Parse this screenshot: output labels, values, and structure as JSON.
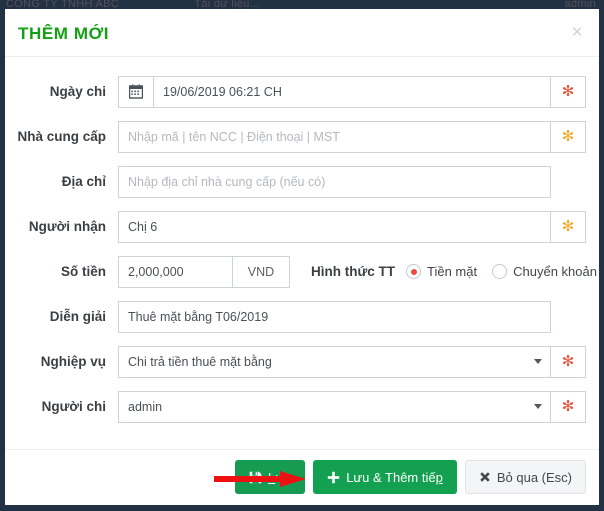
{
  "background": {
    "strip_left": "CÔNG TY TNHH ABC",
    "strip_mid": "Tải dữ liệu...",
    "strip_right": "admin",
    "color": "#233145"
  },
  "modal": {
    "title": "THÊM MỚI",
    "title_color": "#13a014",
    "close_icon": "close-icon",
    "close_label": "×"
  },
  "form": {
    "rows": [
      {
        "label": "Ngày chi",
        "type": "date",
        "icon": "calendar-icon",
        "value": "19/06/2019 06:21 CH",
        "required_mark": "✻",
        "required_color": "red"
      },
      {
        "label": "Nhà cung cấp",
        "type": "text",
        "value": "",
        "placeholder": "Nhập mã | tên NCC | Điện thoại | MST",
        "required_mark": "✻",
        "required_color": "orange"
      },
      {
        "label": "Địa chỉ",
        "type": "text",
        "value": "",
        "placeholder": "Nhập địa chỉ nhà cung cấp (nếu có)",
        "required_mark": "",
        "required_color": "none"
      },
      {
        "label": "Người nhận",
        "type": "text",
        "value": "Chị 6",
        "placeholder": "",
        "required_mark": "✻",
        "required_color": "orange"
      },
      {
        "label": "Diễn giải",
        "type": "text",
        "value": "Thuê mặt bằng T06/2019",
        "placeholder": "",
        "required_mark": "",
        "required_color": "none"
      },
      {
        "label": "Nghiệp vụ",
        "type": "select",
        "value": "Chi trả tiền thuê mặt bằng",
        "required_mark": "✻",
        "required_color": "red"
      },
      {
        "label": "Người chi",
        "type": "select",
        "value": "admin",
        "required_mark": "✻",
        "required_color": "red"
      }
    ],
    "amount": {
      "label": "Số tiền",
      "value": "2,000,000",
      "unit": "VND"
    },
    "payment": {
      "title": "Hình thức TT",
      "options": [
        {
          "label": "Tiền mặt",
          "checked": true
        },
        {
          "label": "Chuyển khoản",
          "checked": false
        }
      ]
    }
  },
  "footer": {
    "save": {
      "label": "Lưu",
      "accesskey": "L",
      "icon": "save-icon"
    },
    "save_continue": {
      "label": "Lưu & Thêm tiếp",
      "accesskey": "p",
      "icon": "plus-icon"
    },
    "cancel": {
      "label": "Bỏ qua (Esc)",
      "icon": "times-icon"
    }
  },
  "annotation": {
    "arrow_color": "#ee1111",
    "name": "red-pointer-arrow"
  }
}
